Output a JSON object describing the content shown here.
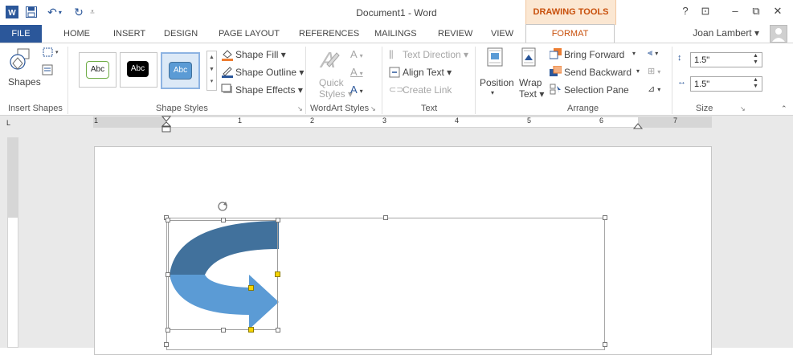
{
  "window": {
    "title": "Document1 - Word",
    "context_tab_group": "DRAWING TOOLS"
  },
  "window_controls": {
    "help": "?",
    "ribbon_options": "⊡",
    "minimize": "–",
    "restore": "⧉",
    "close": "✕"
  },
  "tabs": [
    "FILE",
    "HOME",
    "INSERT",
    "DESIGN",
    "PAGE LAYOUT",
    "REFERENCES",
    "MAILINGS",
    "REVIEW",
    "VIEW",
    "FORMAT"
  ],
  "active_tab": "FORMAT",
  "user": {
    "name": "Joan Lambert ▾"
  },
  "ribbon": {
    "insert_shapes": {
      "shapes_label": "Shapes",
      "group_label": "Insert Shapes"
    },
    "shape_styles": {
      "swatches": [
        "Abc",
        "Abc",
        "Abc"
      ],
      "shape_fill": "Shape Fill ▾",
      "shape_outline": "Shape Outline ▾",
      "shape_effects": "Shape Effects ▾",
      "group_label": "Shape Styles"
    },
    "wordart_styles": {
      "quick_styles": "Quick",
      "quick_styles_2": "Styles ▾",
      "group_label": "WordArt Styles"
    },
    "text": {
      "text_direction": "Text Direction ▾",
      "align_text": "Align Text ▾",
      "create_link": "Create Link",
      "group_label": "Text"
    },
    "arrange": {
      "position": "Position",
      "wrap_text": "Wrap",
      "wrap_text_2": "Text ▾",
      "bring_forward": "Bring Forward",
      "send_backward": "Send Backward",
      "selection_pane": "Selection Pane",
      "group_label": "Arrange"
    },
    "size": {
      "height": "1.5\"",
      "width": "1.5\"",
      "group_label": "Size"
    }
  },
  "ruler": {
    "numbers": [
      "1",
      "1",
      "2",
      "3",
      "4",
      "5",
      "6",
      "7"
    ],
    "corner": "L"
  },
  "colors": {
    "accent": "#2b579a",
    "context": "#c8500c",
    "shape_fill": "#5b9bd5",
    "shape_dark": "#41719c"
  }
}
